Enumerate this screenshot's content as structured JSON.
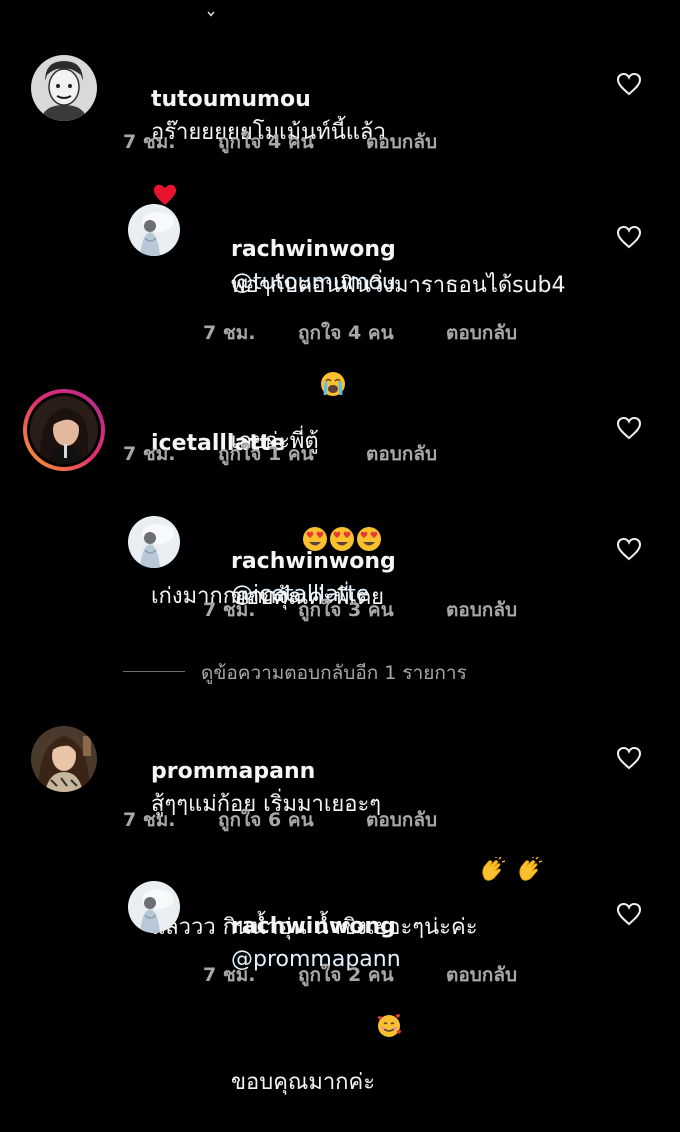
{
  "comments": [
    {
      "username": "tutoumumou",
      "text_line1": "อร๊ายยยยยโมเม้นท์นี้แล้ว",
      "text_line2_emoji": "red-heart",
      "time": "7 ชม.",
      "likes": "ถูกใจ 4 คน",
      "reply": "ตอบกลับ"
    },
    {
      "username": "rachwinwong",
      "mention": "@tutoumumou",
      "text_line2": "พอๆกับตอนฟินวิ่งมาราธอนได้sub4",
      "text_line3": "เลยอ่ะพี่ตู้",
      "emoji": "loudly-crying-face",
      "time": "7 ชม.",
      "likes": "ถูกใจ 4 คน",
      "reply": "ตอบกลับ"
    },
    {
      "username": "icetalllatte",
      "text": "เก่งมากกกกกจ้ะ",
      "emojis": [
        "heart-eyes-face",
        "heart-eyes-face",
        "heart-eyes-face"
      ],
      "time": "7 ชม.",
      "likes": "ถูกใจ 1 คน",
      "reply": "ตอบกลับ"
    },
    {
      "username": "rachwinwong",
      "mention": "@icetalllatte",
      "text_line2": "ขอบคุณค่ะพี่เตย",
      "time": "7 ชม.",
      "likes": "ถูกใจ 3 คน",
      "reply": "ตอบกลับ"
    },
    {
      "username": "prommapann",
      "text_line1": "สู้ๆๆแม่ก้อย เริ่มมาเยอะๆ",
      "text_line2": "แล้ววว กินน้ำอุ่น น้ำขิงเยอะๆน่ะค่ะ",
      "emojis": [
        "clapping-hands",
        "clapping-hands"
      ],
      "time": "7 ชม.",
      "likes": "ถูกใจ 6 คน",
      "reply": "ตอบกลับ"
    },
    {
      "username": "rachwinwong",
      "mention": "@prommapann",
      "text_line2": "ขอบคุณมากค่ะ",
      "emoji": "smiling-face-with-hearts",
      "time": "7 ชม.",
      "likes": "ถูกใจ 2 คน",
      "reply": "ตอบกลับ"
    }
  ],
  "view_replies": "ดูข้อความตอบกลับอีก 1 รายการ",
  "colors": {
    "background": "#000000",
    "text": "#f5f5f5",
    "meta": "#a8a8a8",
    "mention": "#e0f1ff",
    "story_ring": "#e1306c"
  },
  "icons": {
    "like": "heart-outline-icon",
    "top": "chevron-down-icon"
  }
}
